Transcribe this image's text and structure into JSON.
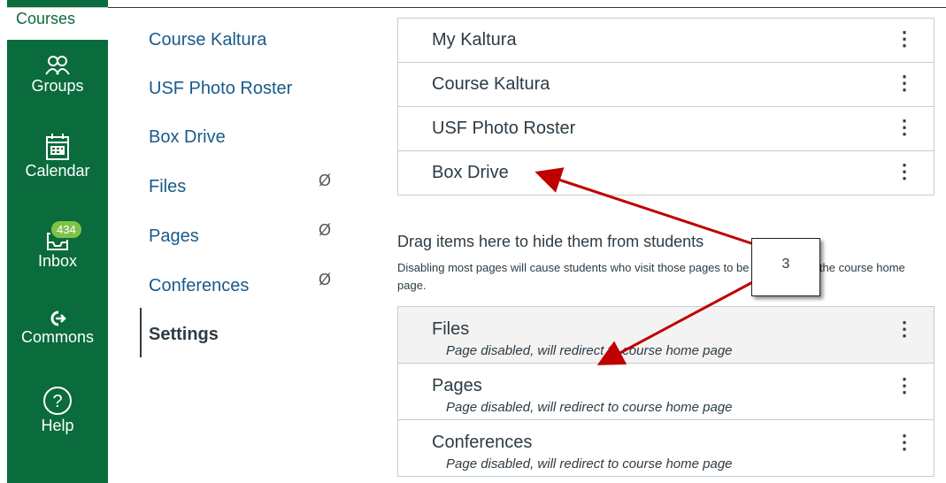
{
  "global_nav": {
    "courses": "Courses",
    "groups": "Groups",
    "calendar": "Calendar",
    "inbox": "Inbox",
    "inbox_badge": "434",
    "commons": "Commons",
    "help": "Help"
  },
  "course_nav": {
    "items": [
      {
        "label": "Course Kaltura",
        "hidden": false
      },
      {
        "label": "USF Photo Roster",
        "hidden": false
      },
      {
        "label": "Box Drive",
        "hidden": false
      },
      {
        "label": "Files",
        "hidden": true
      },
      {
        "label": "Pages",
        "hidden": true
      },
      {
        "label": "Conferences",
        "hidden": true
      }
    ],
    "settings": "Settings"
  },
  "enabled_items": [
    "My Kaltura",
    "Course Kaltura",
    "USF Photo Roster",
    "Box Drive"
  ],
  "drag_section": {
    "title": "Drag items here to hide them from students",
    "description": "Disabling most pages will cause students who visit those pages to be redirected to the course home page."
  },
  "hidden_items": [
    {
      "name": "Files",
      "note": "Page disabled, will redirect to course home page"
    },
    {
      "name": "Pages",
      "note": "Page disabled, will redirect to course home page"
    },
    {
      "name": "Conferences",
      "note": "Page disabled, will redirect to course home page"
    }
  ],
  "callout": {
    "number": "3"
  },
  "kebab_glyph": "⋮",
  "hidden_glyph": "Ø",
  "colors": {
    "nav_green": "#0a6b3d",
    "badge_green": "#7fc24a",
    "link_blue": "#1a5a8a",
    "arrow_red": "#c00000"
  }
}
